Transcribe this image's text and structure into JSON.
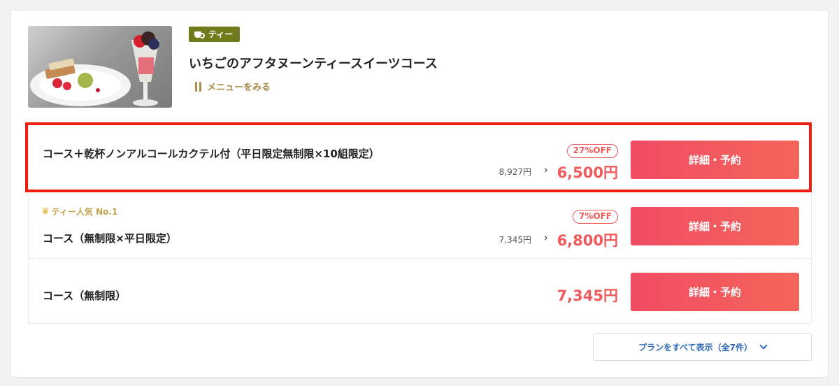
{
  "course": {
    "category_badge": "ティー",
    "title": "いちごのアフタヌーンティースイーツコース",
    "menu_link": "メニューをみる",
    "image_icon": "dessert-photo"
  },
  "plans": [
    {
      "name": "コース＋乾杯ノンアルコールカクテル付（平日限定無制限×10組限定）",
      "original_price": "8,927円",
      "discount": "27%OFF",
      "price": "6,500円",
      "button": "詳細・予約"
    },
    {
      "popular_badge": "ティー人気 No.1",
      "name": "コース（無制限×平日限定）",
      "original_price": "7,345円",
      "discount": "7%OFF",
      "price": "6,800円",
      "button": "詳細・予約"
    },
    {
      "name": "コース（無制限）",
      "price": "7,345円",
      "button": "詳細・予約"
    }
  ],
  "show_all": "プランをすべて表示（全7件）",
  "colors": {
    "accent": "#f05a5a",
    "badge": "#6f7a1a",
    "link": "#2d6bb8",
    "gold": "#a88c4a",
    "highlight": "#f01e10"
  }
}
